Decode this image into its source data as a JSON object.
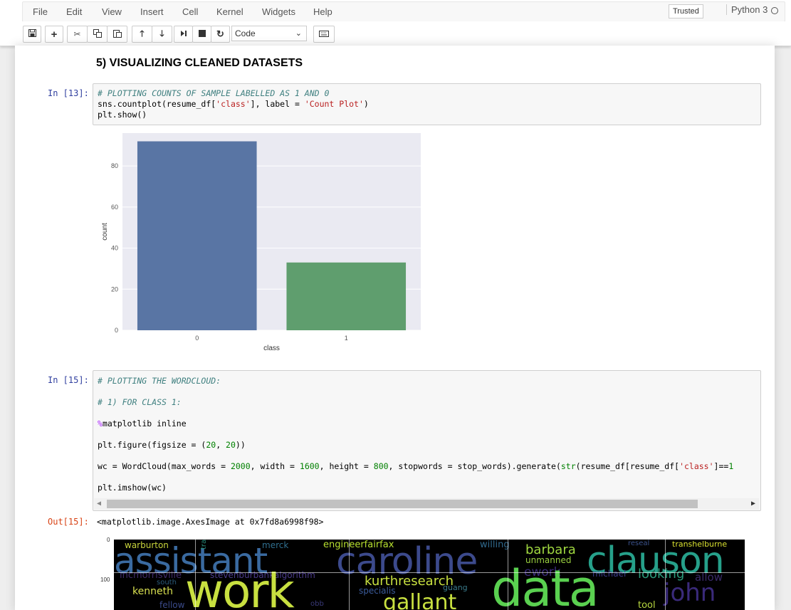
{
  "menu": {
    "items": [
      "File",
      "Edit",
      "View",
      "Insert",
      "Cell",
      "Kernel",
      "Widgets",
      "Help"
    ],
    "trusted": "Trusted",
    "kernel": "Python 3"
  },
  "toolbar": {
    "buttons": [
      "save-icon",
      "plus-icon",
      "cut-icon",
      "copy-icon",
      "paste-icon",
      "arrow-up-icon",
      "arrow-down-icon",
      "run-icon",
      "stop-icon",
      "restart-icon",
      "keyboard-icon"
    ],
    "cell_type": "Code"
  },
  "notebook": {
    "heading": "5) VISUALIZING CLEANED DATASETS",
    "cell13": {
      "prompt": "In [13]:",
      "lines": [
        "# PLOTTING COUNTS OF SAMPLE LABELLED AS 1 AND 0",
        "sns.countplot(resume_df['class'], label = 'Count Plot')",
        "plt.show()"
      ]
    },
    "cell15": {
      "prompt": "In [15]:",
      "lines": [
        "# PLOTTING THE WORDCLOUD:",
        "# 1) FOR CLASS 1:",
        "%matplotlib inline",
        "plt.figure(figsize = (20, 20))",
        "wc = WordCloud(max_words = 2000, width = 1600, height = 800, stopwords = stop_words).generate(str(resume_df[resume_df['class']==1",
        "plt.imshow(wc)"
      ]
    },
    "out15": {
      "prompt": "Out[15]:",
      "text": "<matplotlib.image.AxesImage at 0x7fd8a6998f98>"
    }
  },
  "chart_data": {
    "type": "bar",
    "categories": [
      "0",
      "1"
    ],
    "values": [
      92,
      33
    ],
    "colors": [
      "#5975a4",
      "#5f9e6e"
    ],
    "xlabel": "class",
    "ylabel": "count",
    "yticks": [
      0,
      20,
      40,
      60,
      80
    ],
    "ylim": [
      0,
      96
    ],
    "background": "#eaeaf2",
    "grid": true
  },
  "wordcloud": {
    "yticks": [
      "0",
      "100"
    ],
    "words": [
      {
        "text": "warburton",
        "color": "#c8d43c"
      },
      {
        "text": "merck",
        "color": "#2f6e8e"
      },
      {
        "text": "engineerfairfax",
        "color": "#b8e030"
      },
      {
        "text": "willing",
        "color": "#306a8e"
      },
      {
        "text": "reseal",
        "color": "#3b528b"
      },
      {
        "text": "transhelburne",
        "color": "#d8e030"
      },
      {
        "text": "assistant",
        "color": "#3a6aa0"
      },
      {
        "text": "caroline",
        "color": "#3c4a8c"
      },
      {
        "text": "barbara",
        "color": "#a0d840"
      },
      {
        "text": "unmanned",
        "color": "#9ad040"
      },
      {
        "text": "clauson",
        "color": "#26a08a"
      },
      {
        "text": "tran",
        "color": "#2a8a7a"
      },
      {
        "text": "incmorrisville",
        "color": "#402a6a"
      },
      {
        "text": "stevenburbankalgorithm",
        "color": "#4a3a8a"
      },
      {
        "text": "ework",
        "color": "#3a2a7a"
      },
      {
        "text": "michael",
        "color": "#3a3a8a"
      },
      {
        "text": "looking",
        "color": "#2a9a7a"
      },
      {
        "text": "allow",
        "color": "#3a2a6a"
      },
      {
        "text": "south",
        "color": "#2a5a7a"
      },
      {
        "text": "kurthresearch",
        "color": "#c8e040"
      },
      {
        "text": "specialis",
        "color": "#3a5a9a"
      },
      {
        "text": "guang",
        "color": "#3a7a8a"
      },
      {
        "text": "kenneth",
        "color": "#d8e050"
      },
      {
        "text": "work",
        "color": "#c8e040"
      },
      {
        "text": "data",
        "color": "#5ad050"
      },
      {
        "text": "john",
        "color": "#3a2a7a"
      },
      {
        "text": "gallant",
        "color": "#c8e040"
      },
      {
        "text": "fellow",
        "color": "#3a4a8a"
      },
      {
        "text": "tool",
        "color": "#b8d840"
      },
      {
        "text": "obb",
        "color": "#3a3a7a"
      }
    ]
  }
}
